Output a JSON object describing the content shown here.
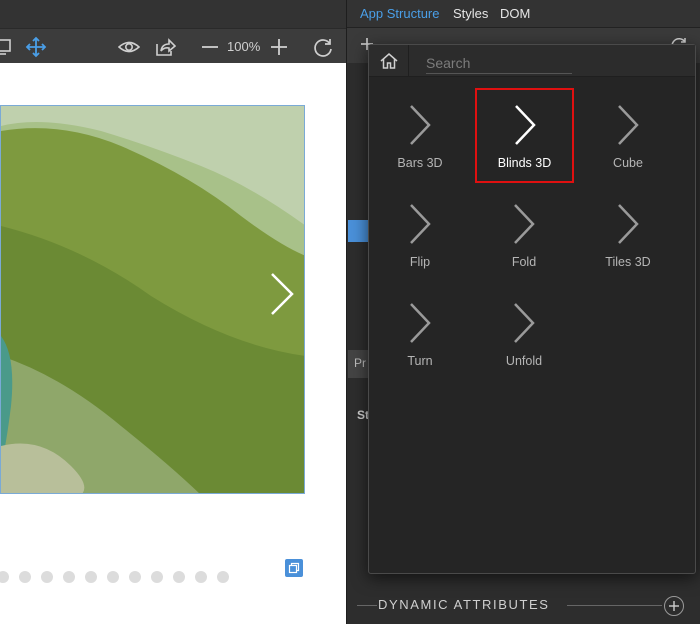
{
  "panel_tabs": [
    {
      "label": "App Structure",
      "active": true
    },
    {
      "label": "Styles",
      "active": false
    },
    {
      "label": "DOM",
      "active": false
    }
  ],
  "toolbar": {
    "zoom": "100%",
    "icons": [
      "monitor-icon",
      "move-icon",
      "eye-icon",
      "share-icon",
      "zoom-out-icon",
      "zoom-in-icon",
      "refresh-icon"
    ]
  },
  "slider": {
    "dot_count": 11,
    "next_icon": "chevron-right-icon"
  },
  "picker": {
    "search_placeholder": "Search",
    "effects": [
      {
        "label": "Bars 3D",
        "selected": false
      },
      {
        "label": "Blinds 3D",
        "selected": true
      },
      {
        "label": "Cube",
        "selected": false
      },
      {
        "label": "Flip",
        "selected": false
      },
      {
        "label": "Fold",
        "selected": false
      },
      {
        "label": "Tiles 3D",
        "selected": false
      },
      {
        "label": "Turn",
        "selected": false
      },
      {
        "label": "Unfold",
        "selected": false
      }
    ]
  },
  "panel": {
    "prop_stub": "Pr",
    "st_stub": "St",
    "dynamic_attributes_label": "DYNAMIC ATTRIBUTES"
  },
  "colors": {
    "accent": "#4a9fe8",
    "selection": "#e01010",
    "panel_bg": "#2d2d2d",
    "popup_bg": "#252525"
  }
}
